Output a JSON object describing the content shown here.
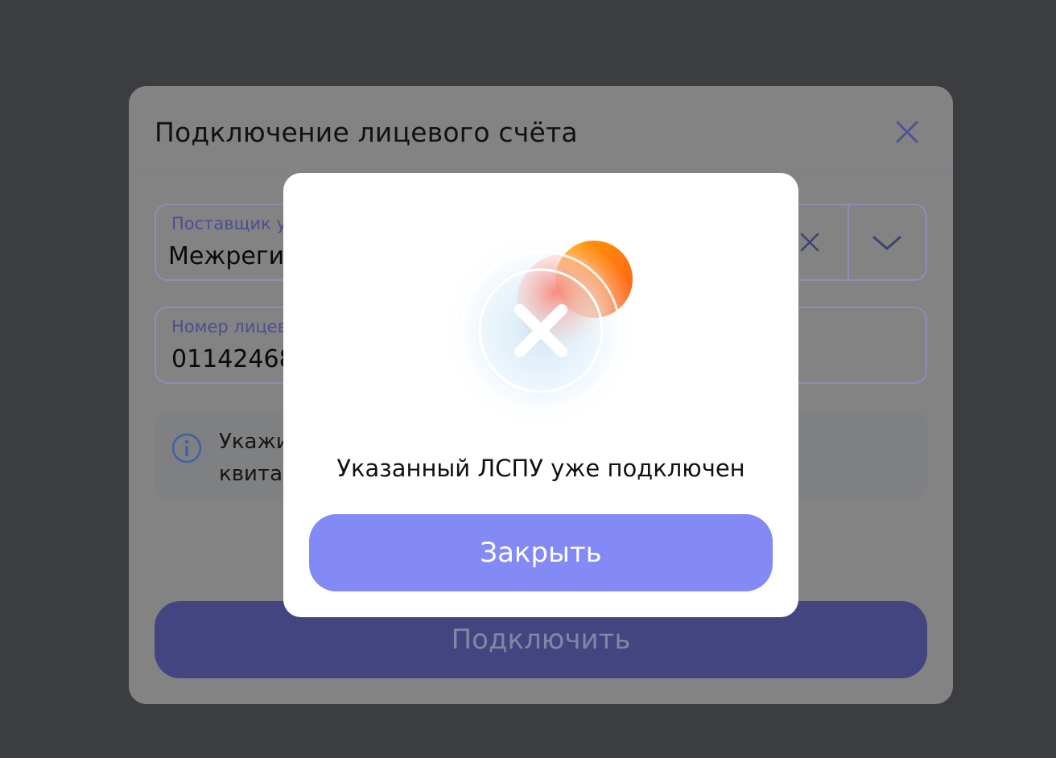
{
  "dialog": {
    "title": "Подключение лицевого счёта",
    "close_icon": "close-icon",
    "provider_field": {
      "label": "Поставщик услуг",
      "value": "Межрегиональная",
      "clear_icon": "clear-icon",
      "dropdown_icon": "chevron-down-icon"
    },
    "account_field": {
      "label": "Номер лицевого счёта",
      "value": "011424680"
    },
    "info": {
      "icon": "info-icon",
      "text": "Укажите номер лицевого счёта так, как он указан в квитанции, без пробелов"
    },
    "connect_button": "Подключить"
  },
  "alert": {
    "icon": "error-icon",
    "message": "Указанный ЛСПУ уже подключен",
    "close_button": "Закрыть"
  },
  "colors": {
    "overlay": "#3c3d41",
    "accent": "#8389f5",
    "accent_dimmed": "#434580",
    "error_orange": "#ff7a00"
  }
}
